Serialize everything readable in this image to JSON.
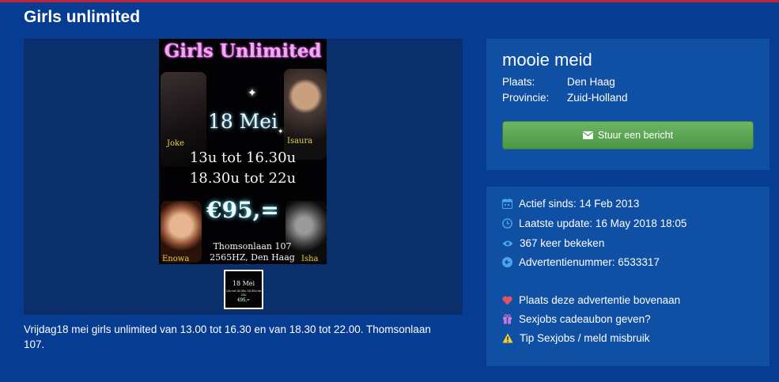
{
  "page": {
    "title": "Girls unlimited"
  },
  "poster": {
    "title": "Girls Unlimited",
    "date": "18 Mei",
    "time1": "13u tot 16.30u",
    "time2": "18.30u tot 22u",
    "price": "€95,=",
    "address1": "Thomsonlaan 107",
    "address2": "2565HZ, Den Haag",
    "names": [
      "Joke",
      "Isaura",
      "Enowa",
      "Isha"
    ]
  },
  "thumbnail": {
    "date": "18 Mei",
    "times": "13u tot 16.30u 18.30u tot 22u",
    "price": "€95,="
  },
  "description": "Vrijdag18 mei girls unlimited van 13.00 tot 16.30 en van 18.30 tot 22.00. Thomsonlaan 107.",
  "listing": {
    "title": "mooie meid",
    "place_label": "Plaats:",
    "place_value": "Den Haag",
    "province_label": "Provincie:",
    "province_value": "Zuid-Holland",
    "message_button": "Stuur een bericht"
  },
  "info": {
    "active_since": "Actief sinds: 14 Feb 2013",
    "last_update": "Laatste update: 16 May 2018 18:05",
    "views": "367 keer bekeken",
    "ad_number": "Advertentienummer: 6533317",
    "promote": "Plaats deze advertentie bovenaan",
    "gift": "Sexjobs cadeaubon geven?",
    "report": "Tip Sexjobs / meld misbruik"
  },
  "colors": {
    "background": "#063d92",
    "card": "#0f4fa4",
    "button_green": "#5aa653",
    "icon_blue": "#49a6ea",
    "heart": "#e0526a",
    "gift": "#c87ad8",
    "warning": "#f2d22e",
    "poster_names": "#e8d24a"
  },
  "icons": [
    "envelope-icon",
    "calendar-icon",
    "clock-icon",
    "eye-icon",
    "arrow-left-icon",
    "heart-icon",
    "gift-icon",
    "warning-icon"
  ]
}
